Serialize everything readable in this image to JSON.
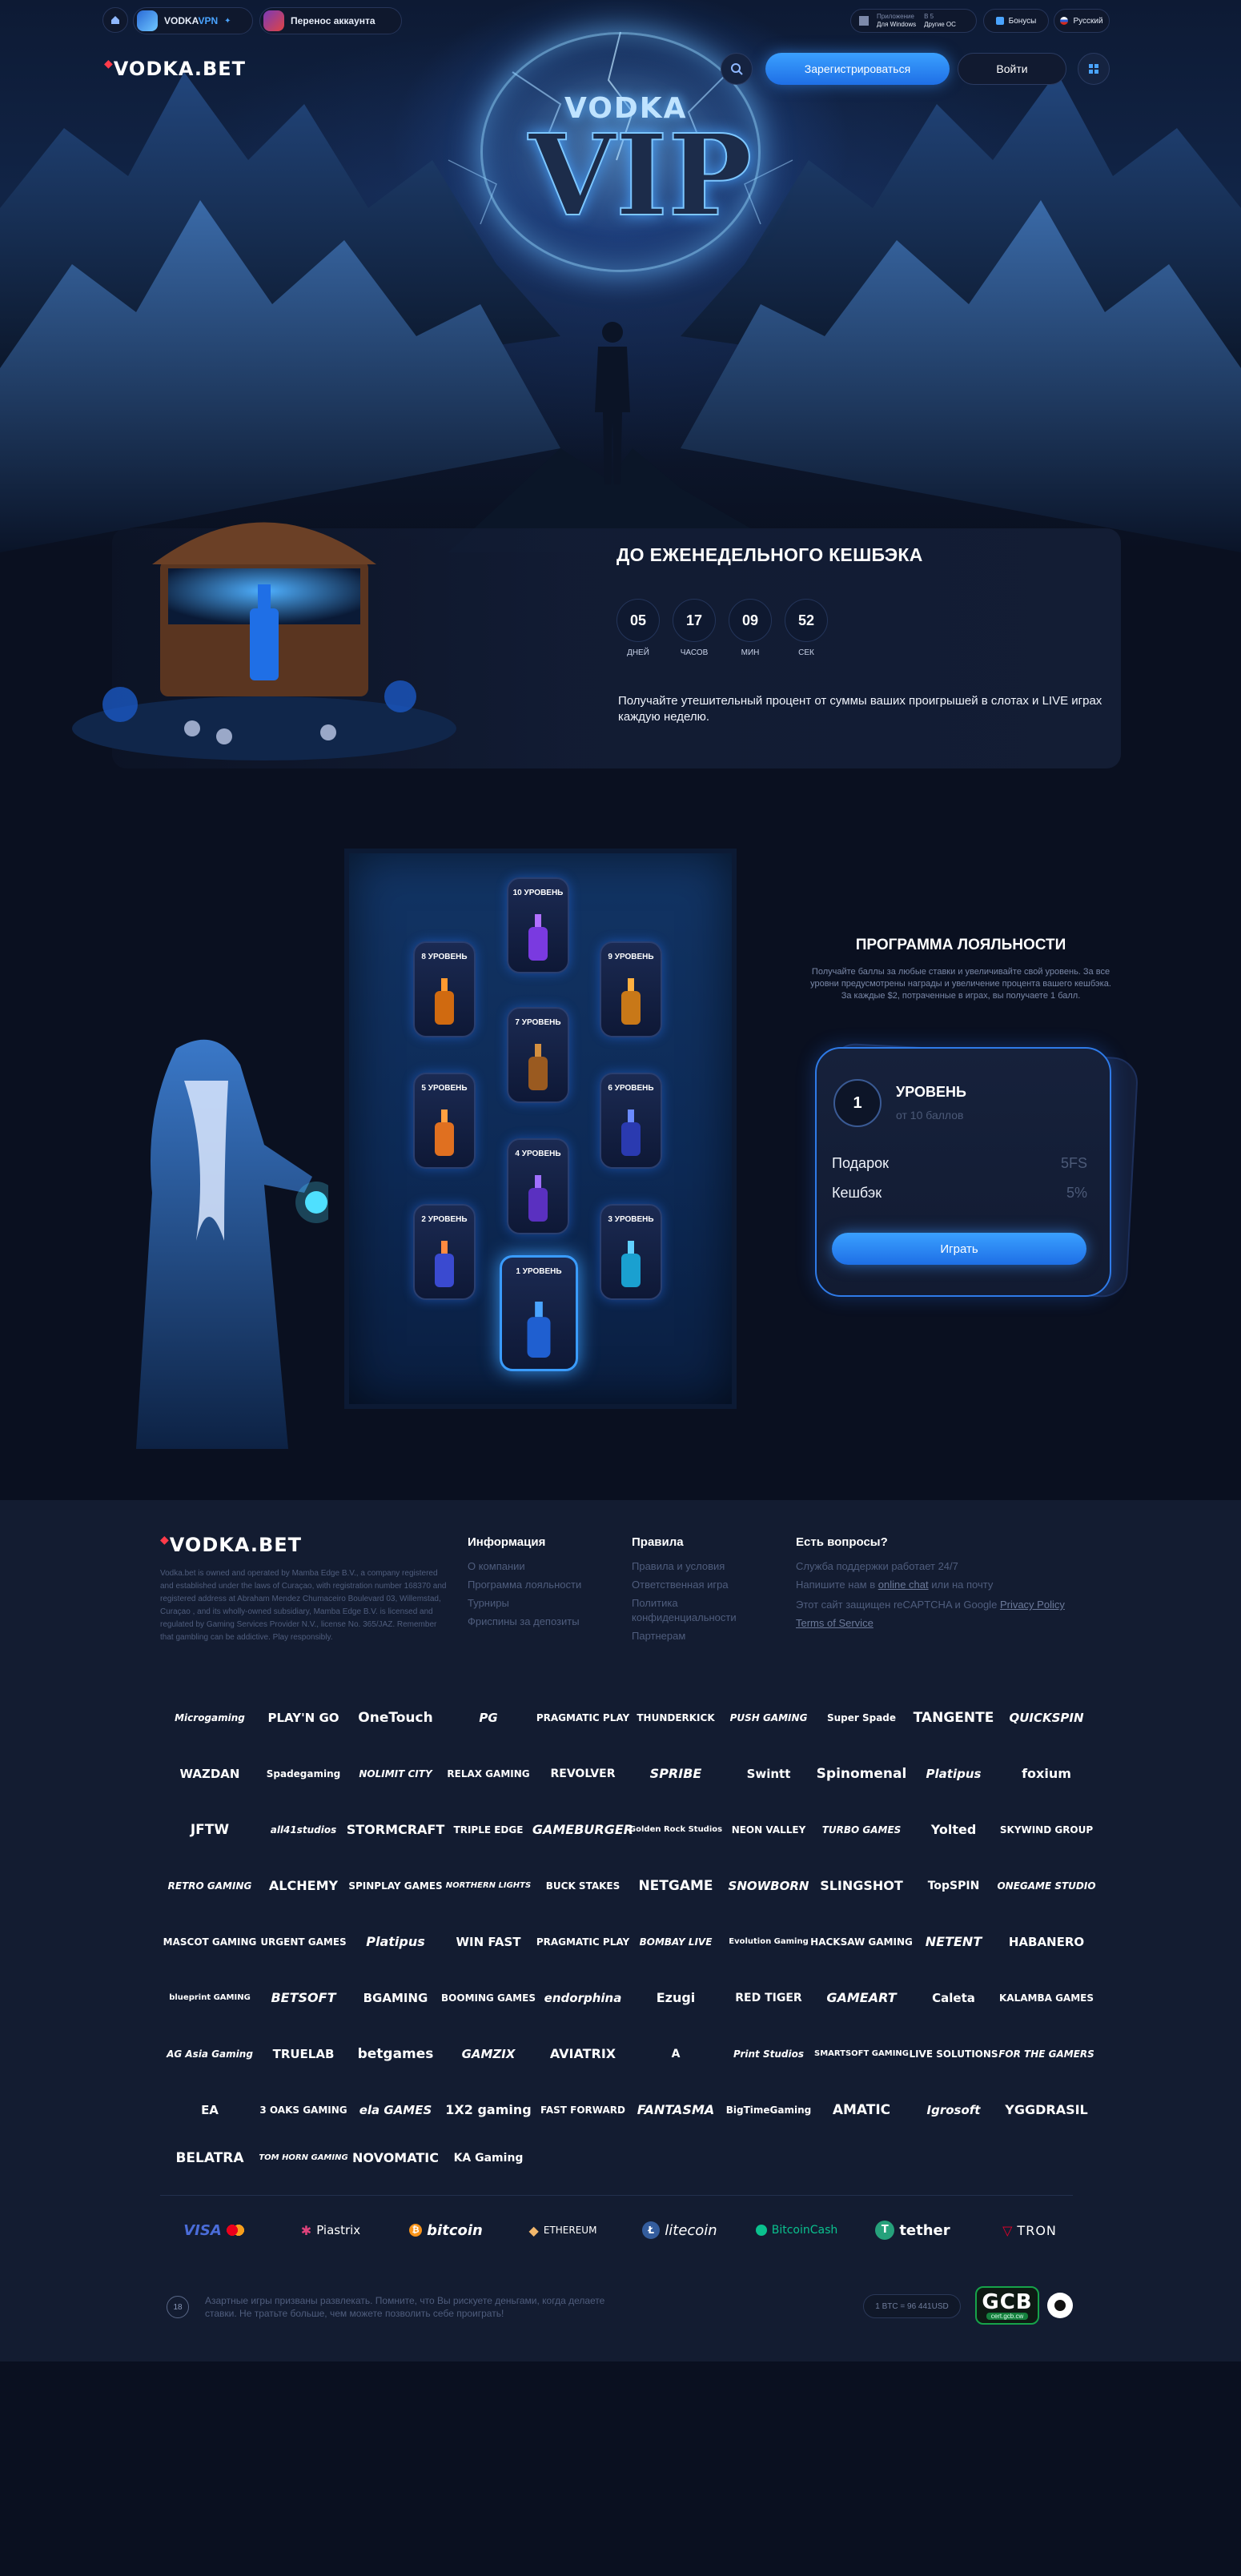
{
  "topbar": {
    "vpn_label_1": "VODKA",
    "vpn_label_2": "VPN",
    "move_label": "Перенос аккаунта",
    "app_line1": "Приложение",
    "app_line2": "Для Windows",
    "app2_line1": "В 5",
    "app2_line2": "Другие ОС",
    "bonus_label": "Бонусы",
    "lang_label": "Русский"
  },
  "header": {
    "logo": "VODKA.BET",
    "register_label": "Зарегистрироваться",
    "login_label": "Войти"
  },
  "hero": {
    "small": "VODKA",
    "big": "VIP"
  },
  "cashback": {
    "title": "ДО ЕЖЕНЕДЕЛЬНОГО КЕШБЭКА",
    "timer": [
      {
        "value": "05",
        "label": "ДНЕЙ"
      },
      {
        "value": "17",
        "label": "ЧАСОВ"
      },
      {
        "value": "09",
        "label": "МИН"
      },
      {
        "value": "52",
        "label": "СЕК"
      }
    ],
    "description": "Получайте утешительный процент от суммы ваших проигрышей в слотах и LIVE играх каждую неделю."
  },
  "loyalty": {
    "title": "ПРОГРАММА ЛОЯЛЬНОСТИ",
    "description": "Получайте баллы за любые ставки и увеличивайте свой уровень. За все уровни предусмотрены награды и увеличение процента вашего кешбэка. За каждые $2, потраченные в играх, вы получаете 1 балл.",
    "levels": [
      "10 УРОВЕНЬ",
      "8 УРОВЕНЬ",
      "9 УРОВЕНЬ",
      "7 УРОВЕНЬ",
      "5 УРОВЕНЬ",
      "6 УРОВЕНЬ",
      "4 УРОВЕНЬ",
      "2 УРОВЕНЬ",
      "3 УРОВЕНЬ",
      "1 УРОВЕНЬ"
    ],
    "panel": {
      "number": "1",
      "title": "УРОВЕНЬ",
      "subtitle": "от 10 баллов",
      "gift_label": "Подарок",
      "gift_value": "5FS",
      "cashback_label": "Кешбэк",
      "cashback_value": "5%",
      "play_label": "Играть"
    }
  },
  "footer": {
    "logo": "VODKA.BET",
    "about": "Vodka.bet is owned and operated by Mamba Edge B.V., a company registered and established under the laws of Curaçao, with registration number 168370 and registered address at Abraham Mendez Chumaceiro Boulevard 03, Willemstad, Curaçao , and its wholly-owned subsidiary, Mamba Edge B.V. is licensed and regulated by Gaming Services Provider N.V., license No. 365/JAZ. Remember that gambling can be addictive. Play responsibly.",
    "col1": {
      "title": "Информация",
      "links": [
        "О компании",
        "Программа лояльности",
        "Турниры",
        "Фриспины за депозиты"
      ]
    },
    "col2": {
      "title": "Правила",
      "links": [
        "Правила и условия",
        "Ответственная игра",
        "Политика конфиденциальности",
        "Партнерам"
      ]
    },
    "col3": {
      "title": "Есть вопросы?",
      "support": "Служба поддержки работает 24/7",
      "write_prefix": "Напишите нам в",
      "online_chat": "online chat",
      "write_suffix": "или на почту",
      "recaptcha_prefix": "Этот сайт защищен reCAPTCHA и Google",
      "privacy": "Privacy Policy",
      "terms": "Terms of Service"
    },
    "providers": [
      [
        "Microgaming",
        "PLAY'N GO",
        "OneTouch",
        "PG",
        "PRAGMATIC PLAY",
        "THUNDERKICK",
        "PUSH GAMING",
        "Super Spade",
        "TANGENTE",
        "QUICKSPIN"
      ],
      [
        "WAZDAN",
        "Spadegaming",
        "NOLIMIT CITY",
        "RELAX GAMING",
        "REVOLVER",
        "SPRIBE",
        "Swintt",
        "Spinomenal",
        "Platipus",
        "foxium"
      ],
      [
        "JFTW",
        "all41studios",
        "STORMCRAFT",
        "TRIPLE EDGE",
        "GAMEBURGER",
        "Golden Rock Studios",
        "NEON VALLEY",
        "TURBO GAMES",
        "Yolted",
        "SKYWIND GROUP"
      ],
      [
        "RETRO GAMING",
        "ALCHEMY",
        "SPINPLAY GAMES",
        "NORTHERN LIGHTS",
        "BUCK STAKES",
        "NETGAME",
        "SNOWBORN",
        "SLINGSHOT",
        "TopSPIN",
        "ONEGAME STUDIO"
      ],
      [
        "MASCOT GAMING",
        "URGENT GAMES",
        "Platipus",
        "WIN FAST",
        "PRAGMATIC PLAY",
        "BOMBAY LIVE",
        "Evolution Gaming",
        "HACKSAW GAMING",
        "NETENT",
        "HABANERO"
      ],
      [
        "blueprint GAMING",
        "BETSOFT",
        "BGAMING",
        "BOOMING GAMES",
        "endorphina",
        "Ezugi",
        "RED TIGER",
        "GAMEART",
        "Caleta",
        "KALAMBA GAMES"
      ],
      [
        "AG Asia Gaming",
        "TRUELAB",
        "betgames",
        "GAMZIX",
        "AVIATRIX",
        "A",
        "Print Studios",
        "SMARTSOFT GAMING",
        "LIVE SOLUTIONS",
        "FOR THE GAMERS"
      ],
      [
        "EA",
        "3 OAKS GAMING",
        "ela GAMES",
        "1X2 gaming",
        "FAST FORWARD",
        "FANTASMA",
        "BigTimeGaming",
        "AMATIC",
        "Igrosoft",
        "YGGDRASIL"
      ],
      [
        "BELATRA",
        "TOM HORN GAMING",
        "NOVOMATIC",
        "KA Gaming"
      ]
    ],
    "payments": [
      "VISA",
      "Piastrix",
      "bitcoin",
      "ETHEREUM",
      "litecoin",
      "BitcoinCash",
      "tether",
      "TRON"
    ],
    "age_badge": "18",
    "disclaimer": "Азартные игры призваны развлекать. Помните, что Вы рискуете деньгами, когда делаете ставки. Не тратьте больше, чем можете позволить себе проиграть!",
    "rate": "1 BTC = 96 441USD",
    "gcb_big": "GCB",
    "gcb_small": "cert.gcb.cw"
  },
  "colors": {
    "accent_blue": "#2f8cff",
    "bg": "#0a1020",
    "footer_bg": "#131c31",
    "muted": "#4f5d7d"
  }
}
